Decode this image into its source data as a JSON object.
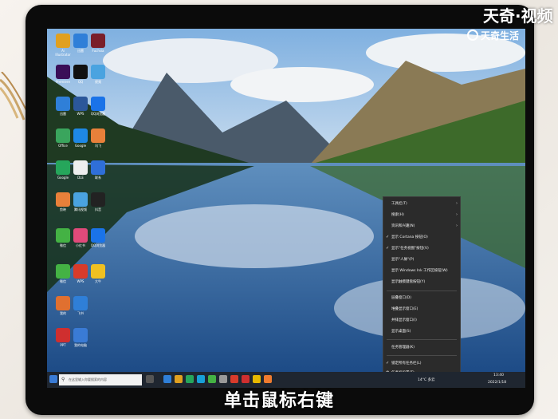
{
  "watermark": {
    "brand": "天奇·视频",
    "sub": "天奇生活"
  },
  "subtitle": "单击鼠标右键",
  "desktop": {
    "icons": [
      "Ai Illustrator",
      "迅雷",
      "Fuchsia",
      "Premiere",
      "QQ",
      "视频",
      "迅雷",
      "WPS",
      "QQ浏览器",
      "Office",
      "Google",
      "讯飞",
      "Google",
      "DLE",
      "联系",
      "剪映",
      "腾讯视频",
      "抖音",
      "微信",
      "小红书",
      "QQ浏览器",
      "微信",
      "WPS",
      "大牛",
      "我的",
      "飞书",
      "PPT",
      "我的电脑",
      "Edge",
      "EasyConnect"
    ]
  },
  "context_menu": {
    "items": [
      {
        "label": "工具栏(T)",
        "arrow": true,
        "check": false
      },
      {
        "label": "搜索(H)",
        "arrow": true,
        "check": false
      },
      {
        "label": "资讯和兴趣(N)",
        "arrow": true,
        "check": false
      },
      {
        "label": "显示 Cortana 按钮(O)",
        "check": true
      },
      {
        "label": "显示\"任务视图\"按钮(V)",
        "check": true
      },
      {
        "label": "显示\"人脉\"(P)",
        "check": false
      },
      {
        "label": "显示 Windows Ink 工作区按钮(W)",
        "check": false
      },
      {
        "label": "显示触摸键盘按钮(Y)",
        "check": false
      },
      {
        "label": "层叠窗口(D)",
        "check": false
      },
      {
        "label": "堆叠显示窗口(E)",
        "check": false
      },
      {
        "label": "并排显示窗口(I)",
        "check": false
      },
      {
        "label": "显示桌面(S)",
        "check": false
      },
      {
        "label": "任务管理器(K)",
        "check": false
      },
      {
        "label": "锁定所有任务栏(L)",
        "check": true
      },
      {
        "label": "任务栏设置(T)",
        "icon": true
      }
    ]
  },
  "taskbar": {
    "search_placeholder": "在这里输入你要搜索的内容",
    "weather": "14°C 多云",
    "time": "13:40",
    "date": "2022/1/18"
  }
}
